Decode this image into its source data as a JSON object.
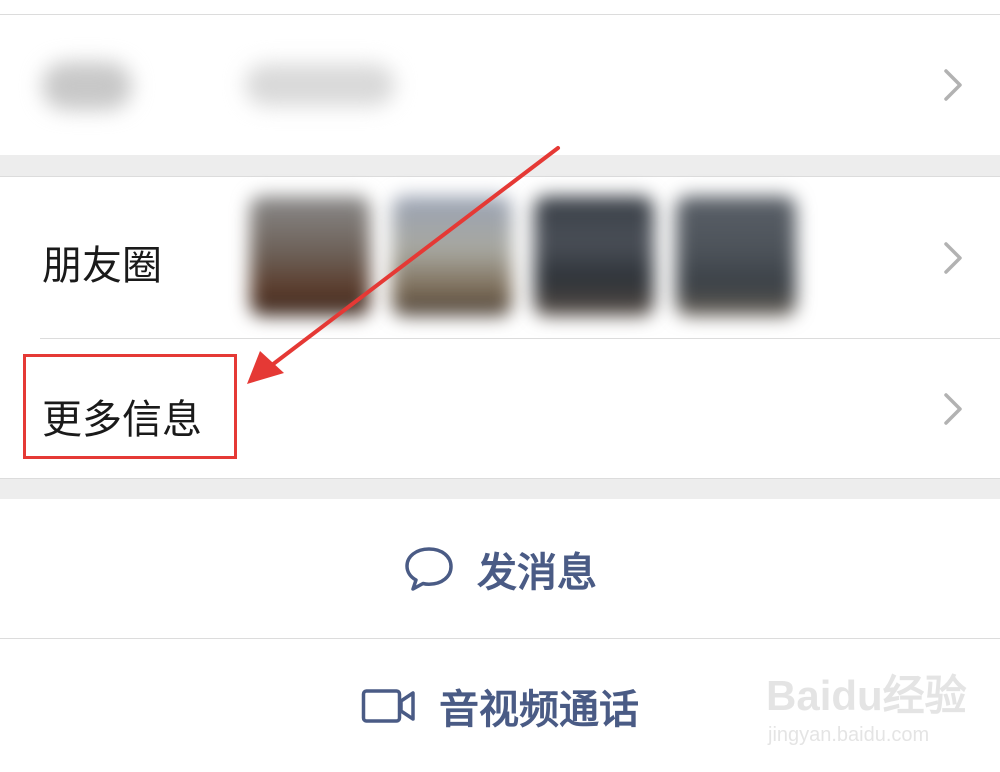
{
  "rows": {
    "moments_label": "朋友圈",
    "more_info_label": "更多信息"
  },
  "actions": {
    "send_message": "发消息",
    "av_call": "音视频通话"
  },
  "icons": {
    "chevron": "chevron-right-icon",
    "message": "chat-bubble-icon",
    "video": "video-camera-icon"
  },
  "watermark": {
    "logo": "Baidu经验",
    "url": "jingyan.baidu.com"
  },
  "colors": {
    "accent_text": "#4a5b85",
    "highlight": "#e53935",
    "separator": "#ededed"
  }
}
